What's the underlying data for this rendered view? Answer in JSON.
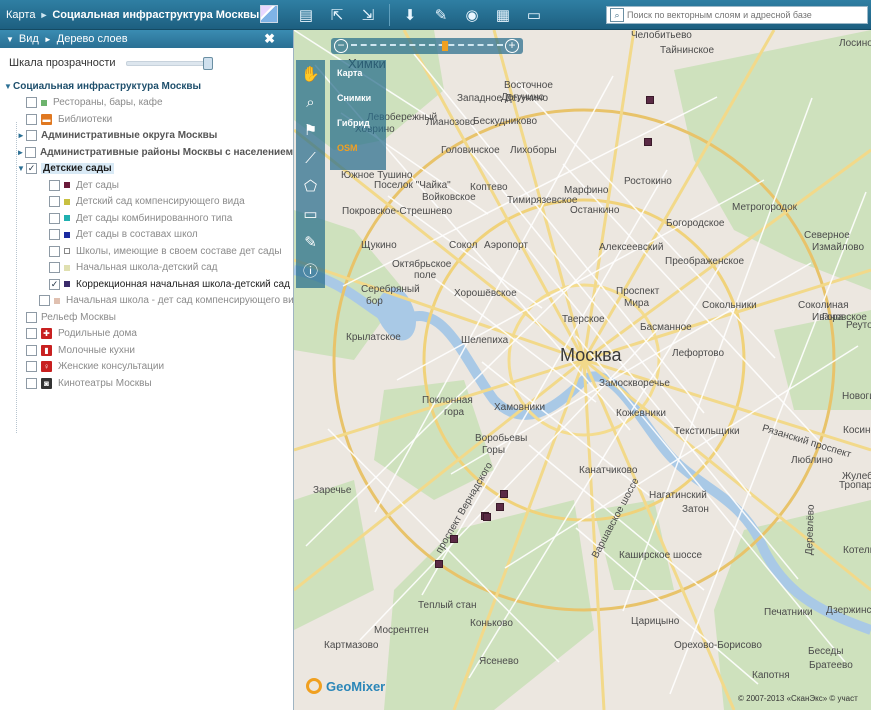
{
  "breadcrumb": {
    "root": "Карта",
    "title": "Социальная инфраструктура Москвы"
  },
  "toolbar": {
    "icons": [
      "save-map-icon",
      "export-icon",
      "share-icon",
      "download-icon",
      "attach-icon",
      "globe-icon",
      "layers-icon",
      "print-icon"
    ]
  },
  "search": {
    "placeholder": "Поиск по векторным слоям и адресной базе"
  },
  "sidebar": {
    "view_label": "Вид",
    "panel_title": "Дерево слоев",
    "close": "✖",
    "opacity_label": "Шкала прозрачности",
    "opacity_value": 0.95,
    "root_label": "Социальная инфраструктура Москвы",
    "items": [
      {
        "label": "Рестораны, бары, кафе",
        "checked": false,
        "swatch": "#6db36d"
      },
      {
        "label": "Библиотеки",
        "checked": false,
        "icon": "book-icon",
        "icon_color": "#e07820"
      },
      {
        "label": "Административные округа Москвы",
        "checked": false,
        "bold": true
      },
      {
        "label": "Административные районы Москвы с населением",
        "checked": false,
        "bold": true
      },
      {
        "label": "Детские сады",
        "checked": true,
        "bold": true
      },
      {
        "label": "Рельеф Москвы",
        "checked": false
      },
      {
        "label": "Родильные дома",
        "checked": false,
        "icon": "maternity-icon",
        "icon_color": "#c82020"
      },
      {
        "label": "Молочные кухни",
        "checked": false,
        "icon": "bottle-icon",
        "icon_color": "#c82020"
      },
      {
        "label": "Женские консультации",
        "checked": false,
        "icon": "female-icon",
        "icon_color": "#c82020"
      },
      {
        "label": "Кинотеатры Москвы",
        "checked": false,
        "icon": "cinema-icon",
        "icon_color": "#333333"
      }
    ],
    "children": [
      {
        "label": "Дет сады",
        "checked": false,
        "swatch": "#6a1a3a"
      },
      {
        "label": "Детский сад компенсирующего вида",
        "checked": false,
        "swatch": "#c8c040"
      },
      {
        "label": "Дет сады комбинированного типа",
        "checked": false,
        "swatch": "#20b0b0"
      },
      {
        "label": "Дет сады в составах школ",
        "checked": false,
        "swatch": "#1a2aa0"
      },
      {
        "label": "Школы, имеющие в своем составе дет сады",
        "checked": false,
        "swatch": "#ffffff"
      },
      {
        "label": "Начальная школа-детский сад",
        "checked": false,
        "swatch": "#e0e0b0"
      },
      {
        "label": "Коррекционная начальная школа-детский сад",
        "checked": true,
        "swatch": "#3a2a6a"
      },
      {
        "label": "Начальная школа - дет сад компенсирующего вида",
        "checked": false,
        "swatch": "#e0c0b0"
      }
    ]
  },
  "map": {
    "city_label": "Москва",
    "base_layers": [
      "Карта",
      "Снимки",
      "Гибрид",
      "OSM"
    ],
    "active_base_layer": "OSM",
    "brand": "GeoMixer",
    "copyright": "© 2007-2013 «СканЭкс» © участ",
    "labels": [
      {
        "t": "Химки",
        "cls": "mid"
      },
      {
        "t": "Челобитьево"
      },
      {
        "t": "Тайнинское"
      },
      {
        "t": "Лосиноостровск"
      },
      {
        "t": "Левобережный"
      },
      {
        "t": "Ховрино"
      },
      {
        "t": "Восточное"
      },
      {
        "t": "Дегунино"
      },
      {
        "t": "Западное Дегунино"
      },
      {
        "t": "Бескудниково"
      },
      {
        "t": "Лианозово"
      },
      {
        "t": "Головинское"
      },
      {
        "t": "Лихоборы"
      },
      {
        "t": "Ростокино"
      },
      {
        "t": "Южное Тушино"
      },
      {
        "t": "Поселок \"Чайка\""
      },
      {
        "t": "Войковское"
      },
      {
        "t": "Коптево"
      },
      {
        "t": "Марфино"
      },
      {
        "t": "Тимирязевское"
      },
      {
        "t": "Останкино"
      },
      {
        "t": "Покровское-Стрешнево"
      },
      {
        "t": "Богородское"
      },
      {
        "t": "Метрогородок"
      },
      {
        "t": "Сокол"
      },
      {
        "t": "Аэропорт"
      },
      {
        "t": "Алексеевский"
      },
      {
        "t": "Северное"
      },
      {
        "t": "Измайлово"
      },
      {
        "t": "Щукино"
      },
      {
        "t": "Октябрьское"
      },
      {
        "t": "поле"
      },
      {
        "t": "Преображенское"
      },
      {
        "t": "Серебряный"
      },
      {
        "t": "бор"
      },
      {
        "t": "Хорошёвское"
      },
      {
        "t": "Проспект"
      },
      {
        "t": "Мира"
      },
      {
        "t": "Сокольники"
      },
      {
        "t": "Соколиная"
      },
      {
        "t": "Гора"
      },
      {
        "t": "Крылатское"
      },
      {
        "t": "Тверское"
      },
      {
        "t": "Басманное"
      },
      {
        "t": "Ивановское"
      },
      {
        "t": "Шелепиха"
      },
      {
        "t": "Лефортово"
      },
      {
        "t": "Замоскворечье"
      },
      {
        "t": "Поклонная"
      },
      {
        "t": "гора"
      },
      {
        "t": "Хамовники"
      },
      {
        "t": "Кожевники"
      },
      {
        "t": "Рязанский проспект"
      },
      {
        "t": "Текстильщики"
      },
      {
        "t": "Воробьевы"
      },
      {
        "t": "Горы"
      },
      {
        "t": "Канатчиково"
      },
      {
        "t": "Люблино"
      },
      {
        "t": "Нагатинский"
      },
      {
        "t": "Затон"
      },
      {
        "t": "Заречье"
      },
      {
        "t": "проспект Вернадского"
      },
      {
        "t": "Тропарёво"
      },
      {
        "t": "Деревлёво"
      },
      {
        "t": "Варшавское шоссе"
      },
      {
        "t": "Каширское шоссе"
      },
      {
        "t": "Печатники"
      },
      {
        "t": "Теплый стан"
      },
      {
        "t": "Коньково"
      },
      {
        "t": "Царицыно"
      },
      {
        "t": "Мосрентген"
      },
      {
        "t": "Ясенево"
      },
      {
        "t": "Картмазово"
      },
      {
        "t": "Орехово-Борисово"
      },
      {
        "t": "Дзержинск"
      },
      {
        "t": "Беседы"
      },
      {
        "t": "Братеево"
      },
      {
        "t": "Капотня"
      },
      {
        "t": "Котельники"
      },
      {
        "t": "Жулебино"
      },
      {
        "t": "Новогиреево"
      },
      {
        "t": "Реутов"
      },
      {
        "t": "Косино"
      }
    ]
  }
}
